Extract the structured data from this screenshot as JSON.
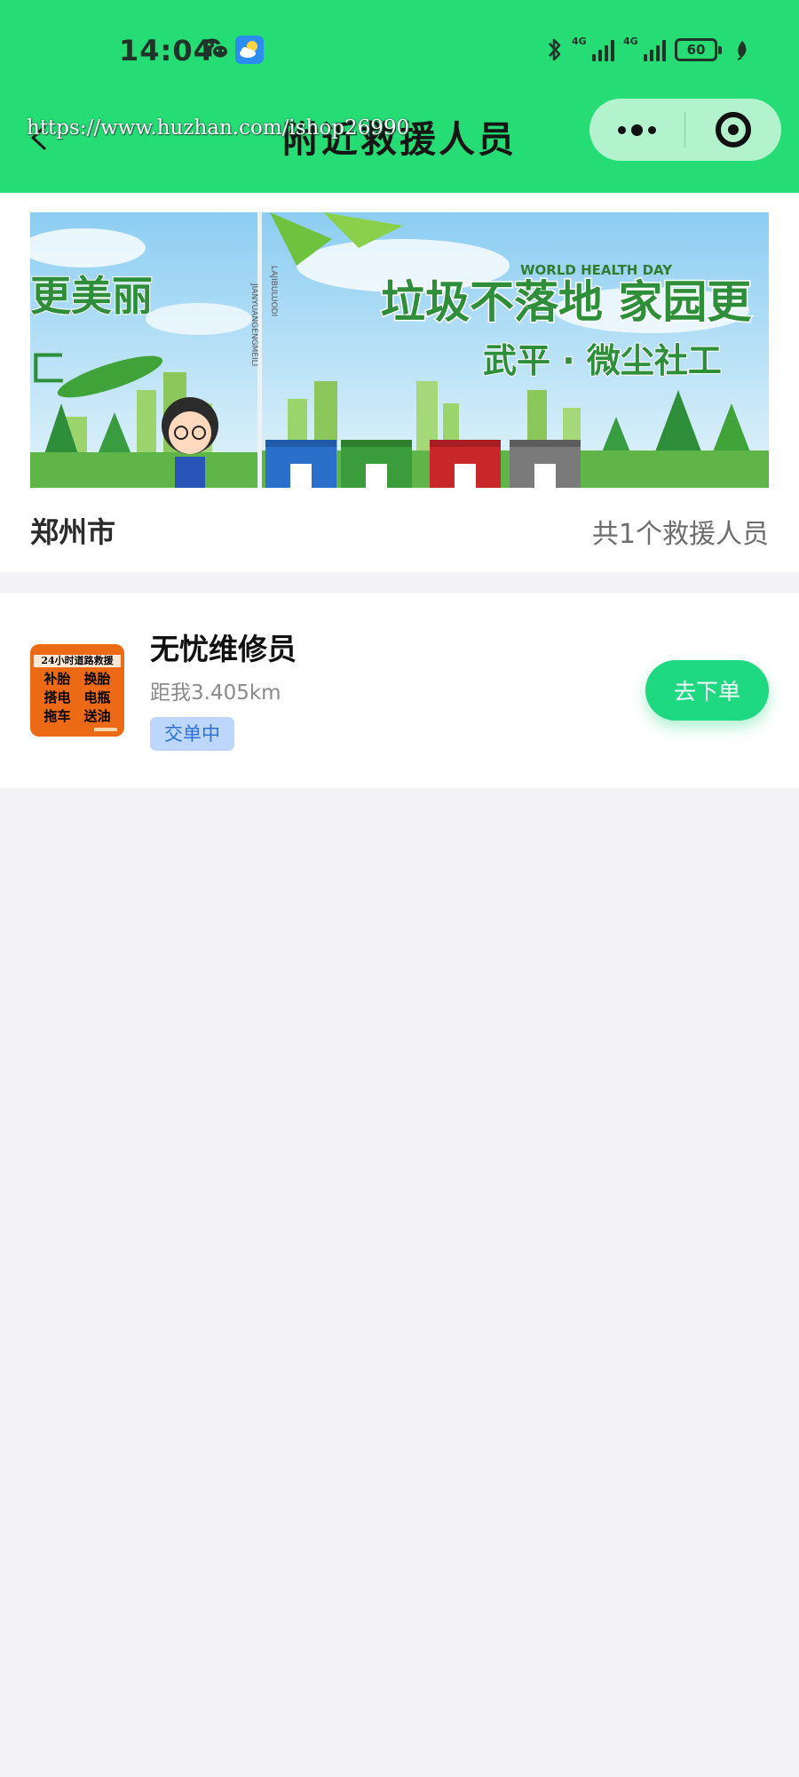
{
  "status_bar": {
    "time": "14:04",
    "network_left": "4G",
    "network_right": "4G",
    "battery": "60"
  },
  "nav": {
    "title": "附近救援人员",
    "watermark": "https://www.huzhan.com/ishop26990"
  },
  "banner": {
    "left_slogan": "更美丽",
    "left_tail": "匚",
    "vertical_text_1": "LAJIBULUODI",
    "vertical_text_2": "JIANYUANGENGMEILI",
    "title_en": "WORLD HEALTH DAY",
    "slogan": "垃圾不落地 家园更",
    "subtitle": "武平 · 微尘社工"
  },
  "summary": {
    "city": "郑州市",
    "count_text": "共1个救援人员"
  },
  "rescuers": [
    {
      "name": "无忧维修员",
      "distance": "距我3.405km",
      "status": "交单中",
      "action": "去下单",
      "avatar": {
        "headline": "24小时道路救援",
        "services": [
          "补胎",
          "换胎",
          "搭电",
          "电瓶",
          "拖车",
          "送油"
        ]
      }
    }
  ],
  "colors": {
    "header_bg": "#25dc75",
    "capsule_bg": "#b2f2cd",
    "page_bg": "#f2f2f7",
    "button_bg": "#1fd882",
    "badge_bg": "#bcd7fb",
    "badge_text": "#2d71d6"
  },
  "icons": [
    "wechat-icon",
    "weather-icon",
    "bluetooth-icon",
    "signal-icon",
    "battery-icon",
    "leaf-icon",
    "back-chevron-icon",
    "more-dots-icon",
    "close-target-icon"
  ]
}
